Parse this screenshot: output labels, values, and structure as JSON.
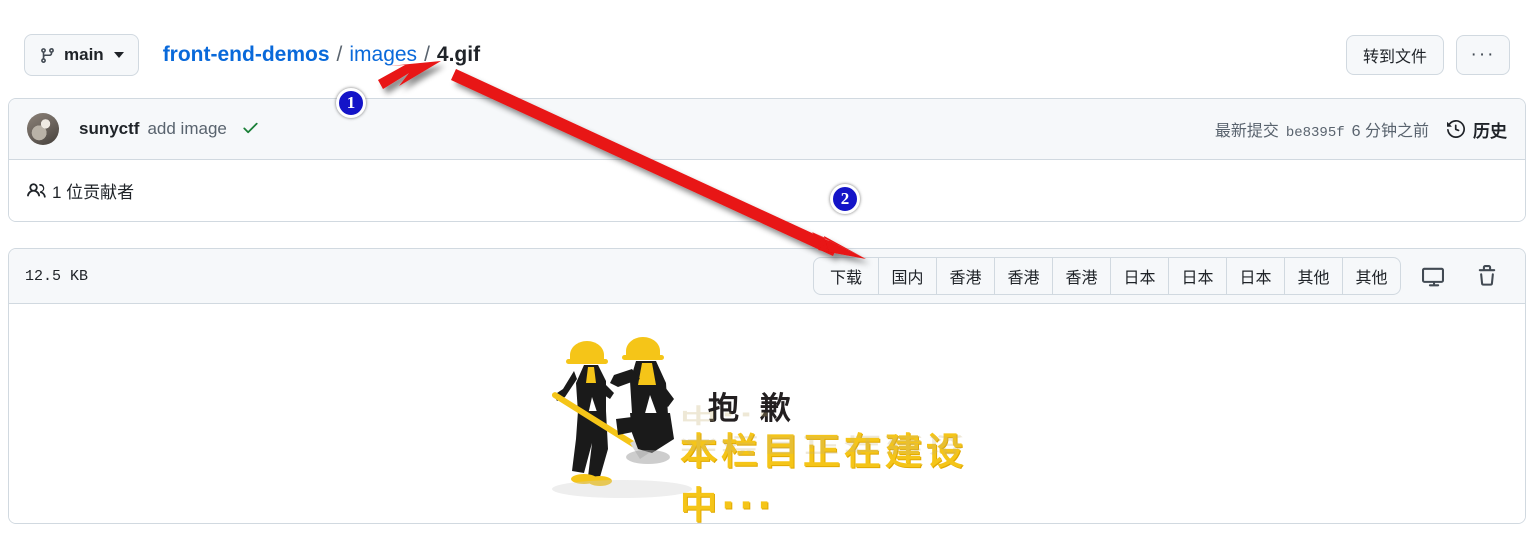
{
  "topbar": {
    "branch": {
      "label": "main",
      "icon": "git-branch-icon",
      "caret": "chevron-down-icon"
    },
    "breadcrumb": {
      "repo": "front-end-demos",
      "sep1": "/",
      "folder": "images",
      "sep2": "/",
      "file": "4.gif"
    },
    "goto_file_label": "转到文件",
    "more_label": "···"
  },
  "commit": {
    "author": "sunyctf",
    "message": "add image",
    "status_icon": "check-icon",
    "latest_label": "最新提交",
    "sha": "be8395f",
    "time": "6 分钟之前",
    "history_label": "历史",
    "history_icon": "history-icon",
    "contributors_icon": "people-icon",
    "contributors_text": "1 位贡献者"
  },
  "file": {
    "size": "12.5 KB",
    "download_buttons": [
      "下载",
      "国内",
      "香港",
      "香港",
      "香港",
      "日本",
      "日本",
      "日本",
      "其他",
      "其他"
    ],
    "display_icon": "monitor-icon",
    "delete_icon": "trash-icon",
    "preview": {
      "sorry_text": "抱 歉",
      "construction_text": "本栏目正在建设中···"
    }
  },
  "annotations": {
    "badge_1": "1",
    "badge_2": "2",
    "arrow_color": "#e81212"
  },
  "colors": {
    "link": "#0969da",
    "muted": "#59636e",
    "border": "#d1d9e0",
    "panel_header_bg": "#f6f8fa",
    "success": "#1a7f37",
    "badge_blue": "#1414c8",
    "gif_yellow": "#f5c518"
  }
}
